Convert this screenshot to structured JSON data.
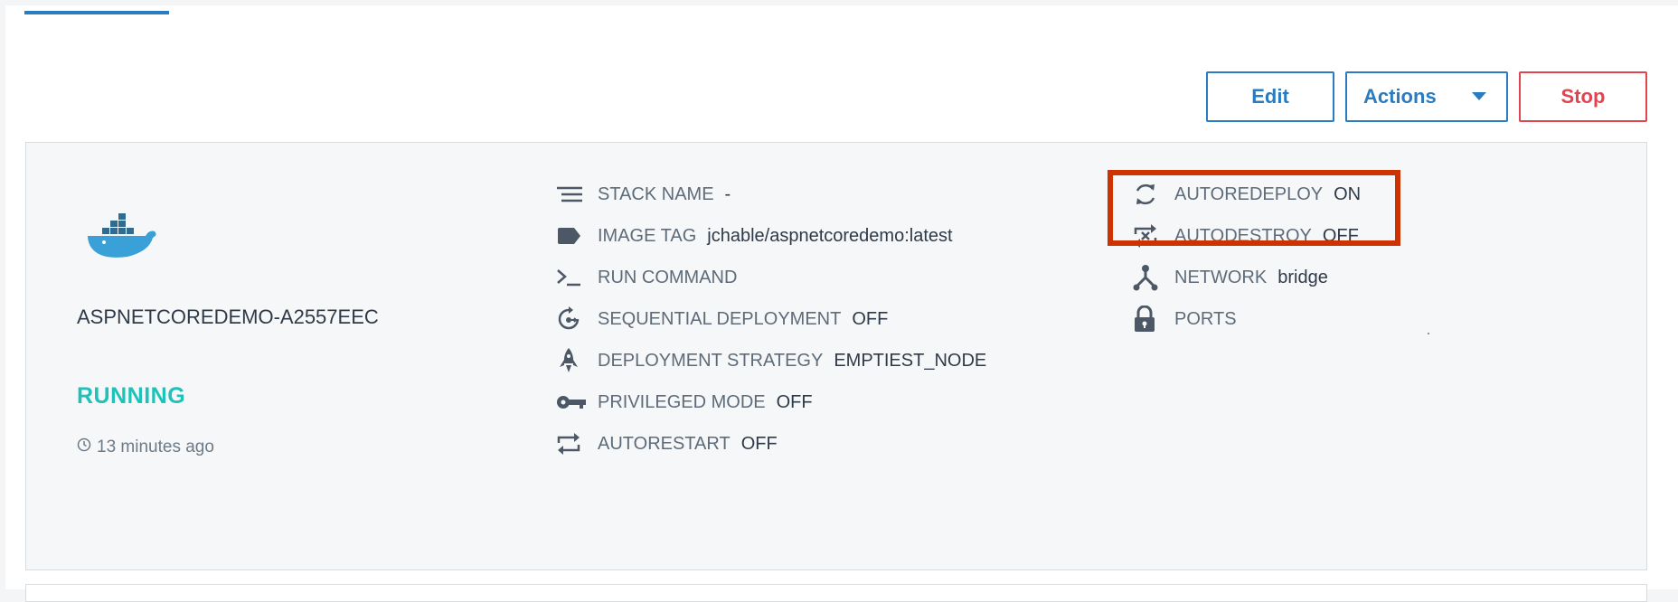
{
  "toolbar": {
    "edit_label": "Edit",
    "actions_label": "Actions",
    "stop_label": "Stop"
  },
  "service": {
    "logo_icon": "docker-whale-icon",
    "name": "ASPNETCOREDEMO-A2557EEC",
    "status": "RUNNING",
    "updated": "13 minutes ago"
  },
  "details_left": [
    {
      "icon": "list-lines-icon",
      "label": "STACK NAME",
      "value": "-"
    },
    {
      "icon": "tag-icon",
      "label": "IMAGE TAG",
      "value": "jchable/aspnetcoredemo:latest"
    },
    {
      "icon": "terminal-icon",
      "label": "RUN COMMAND",
      "value": ""
    },
    {
      "icon": "sequential-deploy-icon",
      "label": "SEQUENTIAL DEPLOYMENT",
      "value": "OFF"
    },
    {
      "icon": "rocket-icon",
      "label": "DEPLOYMENT STRATEGY",
      "value": "EMPTIEST_NODE"
    },
    {
      "icon": "key-icon",
      "label": "PRIVILEGED MODE",
      "value": "OFF"
    },
    {
      "icon": "repeat-icon",
      "label": "AUTORESTART",
      "value": "OFF"
    }
  ],
  "details_right": [
    {
      "icon": "sync-icon",
      "label": "AUTOREDEPLOY",
      "value": "ON"
    },
    {
      "icon": "autodestroy-icon",
      "label": "AUTODESTROY",
      "value": "OFF"
    },
    {
      "icon": "network-icon",
      "label": "NETWORK",
      "value": "bridge"
    },
    {
      "icon": "lock-icon",
      "label": "PORTS",
      "value": ""
    }
  ],
  "colors": {
    "accent": "#2a7bbf",
    "danger": "#e0454f",
    "running": "#1fc2b9",
    "highlight": "#cc3300"
  }
}
